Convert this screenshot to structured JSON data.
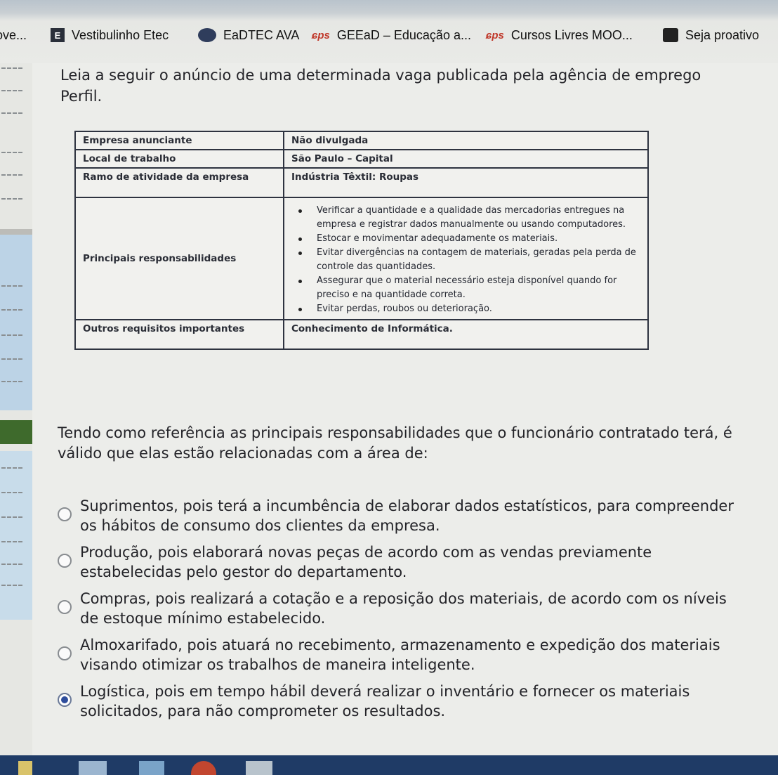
{
  "bookmarks": [
    {
      "label": "ove...",
      "icon": "none"
    },
    {
      "label": "Vestibulinho Etec",
      "icon": "etec-e-icon"
    },
    {
      "label": "EaDTEC AVA",
      "icon": "eadtec-icon"
    },
    {
      "label": "GEEaD – Educação a...",
      "icon": "cps-icon"
    },
    {
      "label": "Cursos Livres MOO...",
      "icon": "cps-icon"
    },
    {
      "label": "Seja proativo",
      "icon": "bookmark-page-icon"
    }
  ],
  "cps_glyph": "ɕps",
  "prompt": {
    "line1": "Leia a seguir o anúncio de uma determinada vaga publicada pela agência de emprego",
    "line2": "Perfil."
  },
  "job_table": {
    "rows": [
      {
        "label": "Empresa anunciante",
        "value": "Não divulgada"
      },
      {
        "label": "Local de trabalho",
        "value": "São Paulo – Capital"
      },
      {
        "label": "Ramo de atividade da empresa",
        "value": "Indústria Têxtil: Roupas"
      }
    ],
    "responsibilities_label": "Principais responsabilidades",
    "responsibilities": [
      "Verificar a quantidade e a qualidade das mercadorias entregues na empresa e registrar dados manualmente ou usando computadores.",
      "Estocar e movimentar adequadamente os materiais.",
      "Evitar divergências na contagem de materiais, geradas pela perda de controle das quantidades.",
      "Assegurar que o material necessário esteja disponível quando for preciso e na quantidade correta.",
      "Evitar perdas, roubos ou deterioração."
    ],
    "other_label": "Outros requisitos importantes",
    "other_value": "Conhecimento de Informática."
  },
  "question": "Tendo como referência as principais responsabilidades que o funcionário contratado terá, é válido que elas estão relacionadas com a área de:",
  "options": [
    {
      "text": "Suprimentos, pois terá a incumbência de elaborar dados estatísticos, para compreender os hábitos de consumo dos clientes da empresa.",
      "selected": false
    },
    {
      "text": "Produção, pois elaborará novas peças de acordo com as vendas previamente estabelecidas pelo gestor do departamento.",
      "selected": false
    },
    {
      "text": "Compras, pois realizará a cotação e a reposição dos materiais, de acordo com os níveis de estoque mínimo estabelecido.",
      "selected": false
    },
    {
      "text": "Almoxarifado, pois atuará no recebimento, armazenamento e expedição dos materiais visando otimizar os trabalhos de maneira inteligente.",
      "selected": false
    },
    {
      "text": "Logística, pois em tempo hábil deverá realizar o inventário e fornecer os materiais solicitados, para não comprometer os resultados.",
      "selected": true
    }
  ],
  "colors": {
    "accent": "#2e4d9c",
    "taskbar": "#1f3b66",
    "cps_red": "#c0392b"
  }
}
